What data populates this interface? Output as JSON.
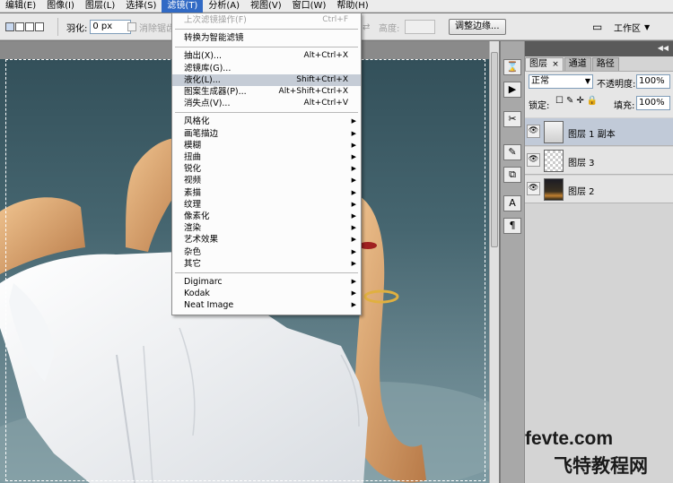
{
  "menubar": {
    "items": [
      {
        "label": "编辑(E)"
      },
      {
        "label": "图像(I)"
      },
      {
        "label": "图层(L)"
      },
      {
        "label": "选择(S)"
      },
      {
        "label": "滤镜(T)"
      },
      {
        "label": "分析(A)"
      },
      {
        "label": "视图(V)"
      },
      {
        "label": "窗口(W)"
      },
      {
        "label": "帮助(H)"
      }
    ],
    "active_index": 4
  },
  "options": {
    "feather_label": "羽化:",
    "feather_value": "0 px",
    "antialias_label": "消除锯齿",
    "height_label": "高度:",
    "refine_edge_label": "调整边缘...",
    "workspace_label": "工作区",
    "workspace_arrow": "▼"
  },
  "filter_menu": {
    "items": [
      {
        "label": "上次滤镜操作(F)",
        "shortcut": "Ctrl+F",
        "disabled": true
      },
      {
        "separator": true
      },
      {
        "label": "转换为智能滤镜"
      },
      {
        "separator": true
      },
      {
        "label": "抽出(X)...",
        "shortcut": "Alt+Ctrl+X"
      },
      {
        "label": "滤镜库(G)..."
      },
      {
        "label": "液化(L)...",
        "shortcut": "Shift+Ctrl+X",
        "highlighted": true
      },
      {
        "label": "图案生成器(P)...",
        "shortcut": "Alt+Shift+Ctrl+X"
      },
      {
        "label": "消失点(V)...",
        "shortcut": "Alt+Ctrl+V"
      },
      {
        "separator": true
      },
      {
        "label": "风格化",
        "submenu": true
      },
      {
        "label": "画笔描边",
        "submenu": true
      },
      {
        "label": "模糊",
        "submenu": true
      },
      {
        "label": "扭曲",
        "submenu": true
      },
      {
        "label": "锐化",
        "submenu": true
      },
      {
        "label": "视频",
        "submenu": true
      },
      {
        "label": "素描",
        "submenu": true
      },
      {
        "label": "纹理",
        "submenu": true
      },
      {
        "label": "像素化",
        "submenu": true
      },
      {
        "label": "渲染",
        "submenu": true
      },
      {
        "label": "艺术效果",
        "submenu": true
      },
      {
        "label": "杂色",
        "submenu": true
      },
      {
        "label": "其它",
        "submenu": true
      },
      {
        "separator": true
      },
      {
        "label": "Digimarc",
        "submenu": true
      },
      {
        "label": "Kodak",
        "submenu": true
      },
      {
        "label": "Neat Image",
        "submenu": true
      }
    ],
    "submenu_glyph": "▶"
  },
  "tools_strip": {
    "icons": [
      "history-icon",
      "actions-icon",
      "tool-presets-icon",
      "brushes-icon",
      "clone-source-icon",
      "character-icon",
      "paragraph-icon"
    ],
    "glyphs": [
      "⌛",
      "▶",
      "✂",
      "✎",
      "⧉",
      "A",
      "¶"
    ]
  },
  "layers_panel": {
    "collapse_glyph": "◀◀",
    "tabs": [
      {
        "label": "图层",
        "close": "×"
      },
      {
        "label": "通道"
      },
      {
        "label": "路径"
      }
    ],
    "blend_mode": "正常",
    "opacity_label": "不透明度:",
    "opacity_value": "100%",
    "lock_label": "锁定:",
    "fill_label": "填充:",
    "fill_value": "100%",
    "eye_glyph": "👁",
    "layers": [
      {
        "name": "图层 1 副本",
        "selected": true
      },
      {
        "name": "图层 3"
      },
      {
        "name": "图层 2"
      }
    ]
  },
  "watermark": {
    "line1": "fevte.com",
    "line2": "飞特教程网"
  },
  "colors": {
    "menu_highlight": "#316ac5",
    "filter_item_highlight": "#c5ccd6",
    "selected_layer": "#c1cad8",
    "sky_dark": "#33505a",
    "sky_light": "#7d9aa2"
  }
}
